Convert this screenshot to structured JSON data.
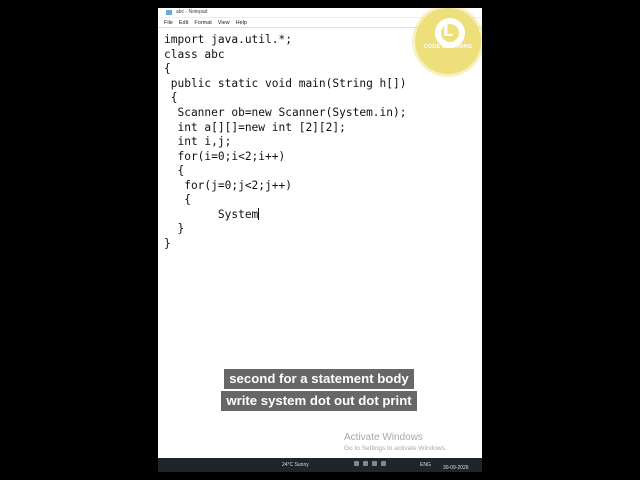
{
  "window": {
    "title": "abc - Notepad"
  },
  "menu": [
    "File",
    "Edit",
    "Format",
    "View",
    "Help"
  ],
  "code_lines": [
    "import java.util.*;",
    "class abc",
    "{",
    " public static void main(String h[])",
    " {",
    "  Scanner ob=new Scanner(System.in);",
    "  int a[][]=new int [2][2];",
    "  int i,j;",
    "  for(i=0;i<2;i++)",
    "  {",
    "   for(j=0;j<2;j++)",
    "   {",
    "        System",
    "  }",
    "}"
  ],
  "logo": {
    "letter": "L",
    "text": "CODE LEARNING",
    "color": "#ede07a"
  },
  "watermark": {
    "title": "Activate Windows",
    "subtitle": "Go to Settings to activate Windows."
  },
  "captions": [
    "second for a statement body",
    "write system dot out dot print"
  ],
  "taskbar": {
    "weather": "24°C Sunny",
    "lang": "ENG",
    "date": "30-09-2026"
  }
}
